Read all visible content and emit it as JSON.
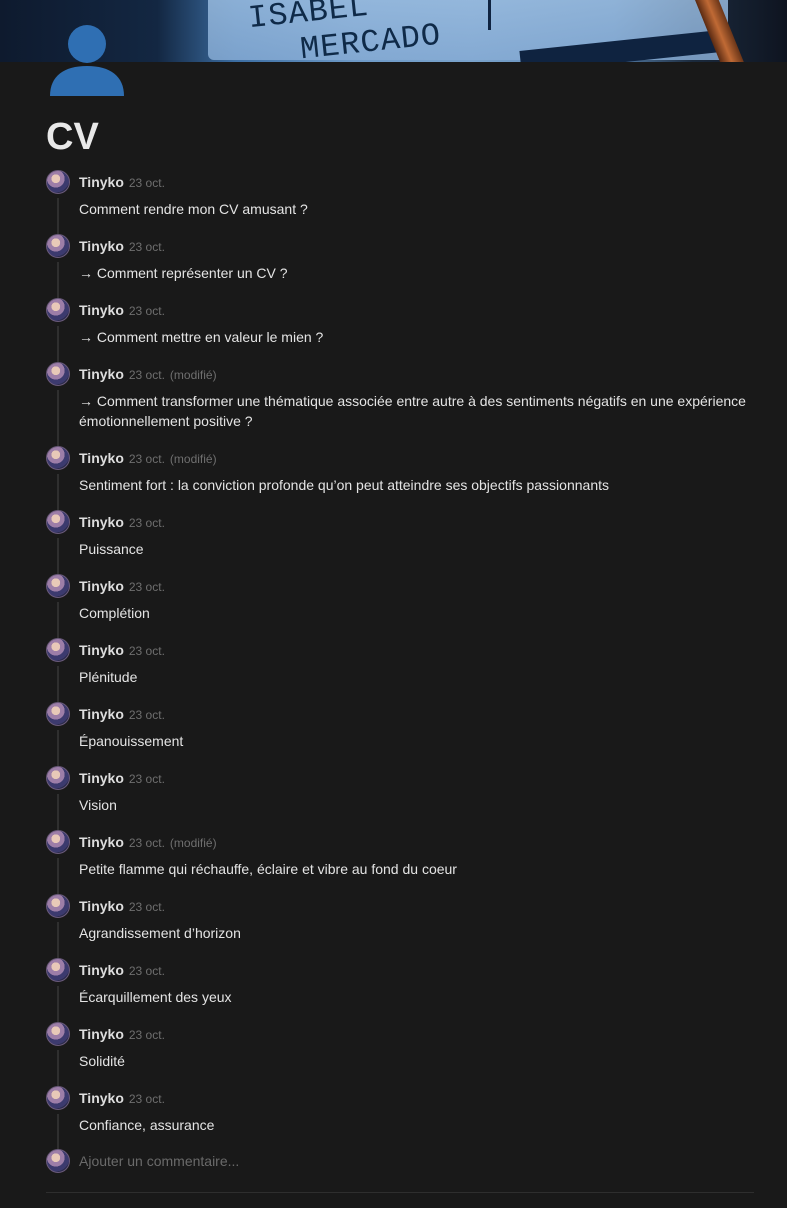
{
  "cover": {
    "text_line_1": "ISABEL",
    "text_line_2": "MERCADO"
  },
  "page": {
    "title": "CV",
    "icon": "user-silhouette-icon"
  },
  "comments": [
    {
      "author": "Tinyko",
      "date": "23 oct.",
      "edited": "",
      "text": "Comment rendre mon CV amusant ?"
    },
    {
      "author": "Tinyko",
      "date": "23 oct.",
      "edited": "",
      "text": "→ Comment représenter un CV ?"
    },
    {
      "author": "Tinyko",
      "date": "23 oct.",
      "edited": "",
      "text": "→ Comment mettre en valeur le mien ?"
    },
    {
      "author": "Tinyko",
      "date": "23 oct.",
      "edited": "(modifié)",
      "text": "→ Comment transformer une thématique associée entre autre à des sentiments négatifs en une expérience émotionnellement positive ?"
    },
    {
      "author": "Tinyko",
      "date": "23 oct.",
      "edited": "(modifié)",
      "text": "Sentiment fort : la conviction profonde qu’on peut atteindre ses objectifs passionnants"
    },
    {
      "author": "Tinyko",
      "date": "23 oct.",
      "edited": "",
      "text": "Puissance"
    },
    {
      "author": "Tinyko",
      "date": "23 oct.",
      "edited": "",
      "text": "Complétion"
    },
    {
      "author": "Tinyko",
      "date": "23 oct.",
      "edited": "",
      "text": "Plénitude"
    },
    {
      "author": "Tinyko",
      "date": "23 oct.",
      "edited": "",
      "text": "Épanouissement"
    },
    {
      "author": "Tinyko",
      "date": "23 oct.",
      "edited": "",
      "text": "Vision"
    },
    {
      "author": "Tinyko",
      "date": "23 oct.",
      "edited": "(modifié)",
      "text": "Petite flamme qui réchauffe, éclaire et vibre au fond du coeur"
    },
    {
      "author": "Tinyko",
      "date": "23 oct.",
      "edited": "",
      "text": "Agrandissement d’horizon"
    },
    {
      "author": "Tinyko",
      "date": "23 oct.",
      "edited": "",
      "text": "Écarquillement des yeux"
    },
    {
      "author": "Tinyko",
      "date": "23 oct.",
      "edited": "",
      "text": "Solidité"
    },
    {
      "author": "Tinyko",
      "date": "23 oct.",
      "edited": "",
      "text": "Confiance, assurance"
    }
  ],
  "add_comment": {
    "placeholder": "Ajouter un commentaire..."
  },
  "colors": {
    "background": "#191919",
    "icon": "#2f6fb3"
  }
}
